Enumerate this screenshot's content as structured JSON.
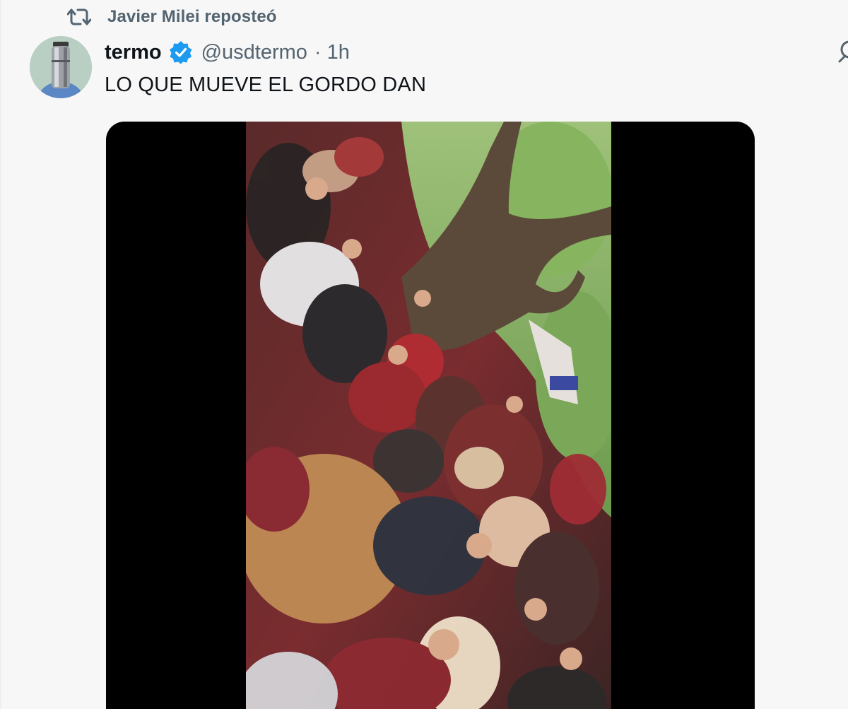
{
  "repost": {
    "icon": "repost-icon",
    "text": "Javier Milei reposteó"
  },
  "author": {
    "avatar_icon": "thermos-avatar",
    "display_name": "termo",
    "verified_icon": "verified-badge-icon",
    "handle": "@usdtermo",
    "separator": "·",
    "time": "1h"
  },
  "tweet": {
    "text": "LO QUE MUEVE EL GORDO DAN"
  },
  "media": {
    "type": "video",
    "description_icon": "crowd-video-frame"
  },
  "colors": {
    "background": "#f7f7f7",
    "text_primary": "#0f1419",
    "text_secondary": "#536471",
    "verified_blue": "#1d9bf0"
  }
}
